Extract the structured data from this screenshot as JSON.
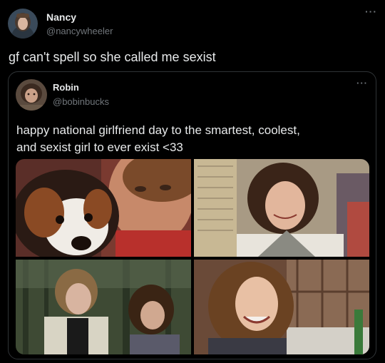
{
  "tweet": {
    "author_name": "Nancy",
    "author_handle": "@nancywheeler",
    "text": "gf can't spell so she called me sexist",
    "more_icon": "more-dots-icon"
  },
  "quoted": {
    "author_name": "Robin",
    "author_handle": "@bobinbucks",
    "text_line1": "happy national girlfriend day to the smartest, coolest,",
    "text_line2": "and sexist girl to ever exist <33",
    "more_icon": "more-dots-icon",
    "photos": [
      "photo-dog-selfie",
      "photo-sweater-portrait",
      "photo-forest-duo",
      "photo-smiling-portrait"
    ]
  },
  "colors": {
    "background": "#000000",
    "text": "#e7e9ea",
    "secondary": "#71767b",
    "border": "#2f3336"
  }
}
